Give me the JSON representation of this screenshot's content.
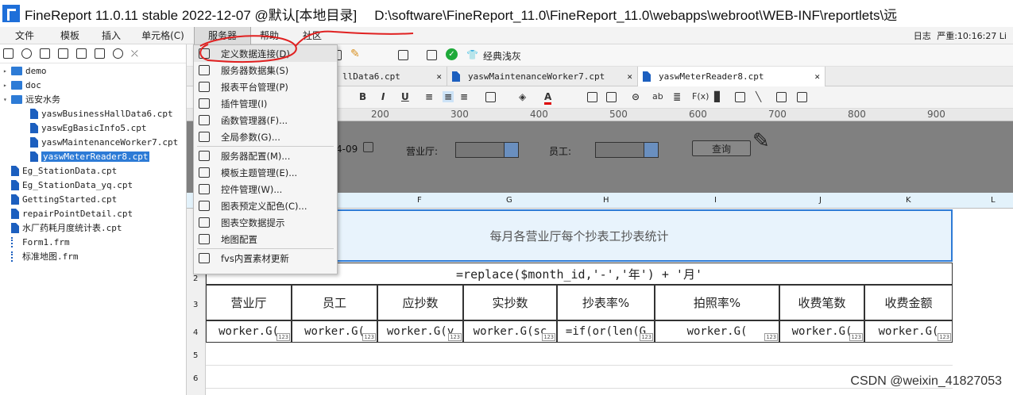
{
  "window": {
    "title": "FineReport 11.0.11 stable 2022-12-07 @默认[本地目录]",
    "path": "D:\\software\\FineReport_11.0\\FineReport_11.0\\webapps\\webroot\\WEB-INF\\reportlets\\远"
  },
  "menubar": {
    "items": [
      "文件",
      "模板",
      "插入",
      "单元格(C)",
      "服务器",
      "帮助",
      "社区"
    ],
    "right_log": "日志",
    "right_status": "严重:10:16:27 Li"
  },
  "tree": {
    "items": [
      {
        "label": "demo",
        "type": "folder",
        "level": 0,
        "expanded": false
      },
      {
        "label": "doc",
        "type": "folder",
        "level": 0,
        "expanded": false
      },
      {
        "label": "远安水务",
        "type": "folder",
        "level": 0,
        "expanded": true
      },
      {
        "label": "yaswBusinessHallData6.cpt",
        "type": "file",
        "level": 1
      },
      {
        "label": "yaswEgBasicInfo5.cpt",
        "type": "file",
        "level": 1
      },
      {
        "label": "yaswMaintenanceWorker7.cpt",
        "type": "file",
        "level": 1
      },
      {
        "label": "yaswMeterReader8.cpt",
        "type": "file",
        "level": 1,
        "selected": true
      },
      {
        "label": "Eg_StationData.cpt",
        "type": "file",
        "level": 0
      },
      {
        "label": "Eg_StationData_yq.cpt",
        "type": "file",
        "level": 0
      },
      {
        "label": "GettingStarted.cpt",
        "type": "file",
        "level": 0
      },
      {
        "label": "repairPointDetail.cpt",
        "type": "file",
        "level": 0
      },
      {
        "label": "水厂药耗月度统计表.cpt",
        "type": "file",
        "level": 0
      },
      {
        "label": "Form1.frm",
        "type": "form",
        "level": 0
      },
      {
        "label": "标准地图.frm",
        "type": "form",
        "level": 0
      }
    ]
  },
  "toolbar": {
    "classic_skin": "经典浅灰"
  },
  "tabs": [
    {
      "label": "llData6.cpt",
      "active": false
    },
    {
      "label": "yaswMaintenanceWorker7.cpt",
      "active": false
    },
    {
      "label": "yaswMeterReader8.cpt",
      "active": true
    }
  ],
  "format_toolbar": {
    "bold": "B",
    "italic": "I",
    "underline": "U",
    "fx": "F(x)",
    "ab": "ab"
  },
  "ruler": {
    "ticks": [
      "200",
      "300",
      "400",
      "500",
      "600",
      "700",
      "800",
      "900"
    ]
  },
  "param_pane": {
    "date_tail": "4-09",
    "hall_label": "营业厅:",
    "worker_label": "员工:",
    "query_button": "查询"
  },
  "columns": [
    "F",
    "G",
    "H",
    "I",
    "J",
    "K",
    "L"
  ],
  "rows": [
    "2",
    "3",
    "4",
    "5",
    "6"
  ],
  "report": {
    "title": "每月各营业厅每个抄表工抄表统计",
    "formula_row": "=replace($month_id,'-','年') + '月'",
    "headers": [
      "营业厅",
      "员工",
      "应抄数",
      "实抄数",
      "抄表率%",
      "拍照率%",
      "收费笔数",
      "收费金额"
    ],
    "cells": [
      "worker.G(",
      "worker.G(",
      "worker.G(y",
      "worker.G(sc",
      "=if(or(len(G",
      "worker.G(",
      "worker.G(",
      "worker.G("
    ],
    "badge": "123"
  },
  "server_menu": {
    "items": [
      {
        "label": "定义数据连接(D)",
        "highlight": true
      },
      {
        "label": "服务器数据集(S)"
      },
      {
        "label": "报表平台管理(P)"
      },
      {
        "label": "插件管理(I)"
      },
      {
        "label": "函数管理器(F)..."
      },
      {
        "label": "全局参数(G)..."
      },
      {
        "label": "服务器配置(M)...",
        "sep_before": true
      },
      {
        "label": "模板主题管理(E)..."
      },
      {
        "label": "控件管理(W)..."
      },
      {
        "label": "图表预定义配色(C)..."
      },
      {
        "label": "图表空数据提示"
      },
      {
        "label": "地图配置"
      },
      {
        "label": "fvs内置素材更新",
        "sep_before": true
      }
    ]
  },
  "watermark": "CSDN @weixin_41827053"
}
